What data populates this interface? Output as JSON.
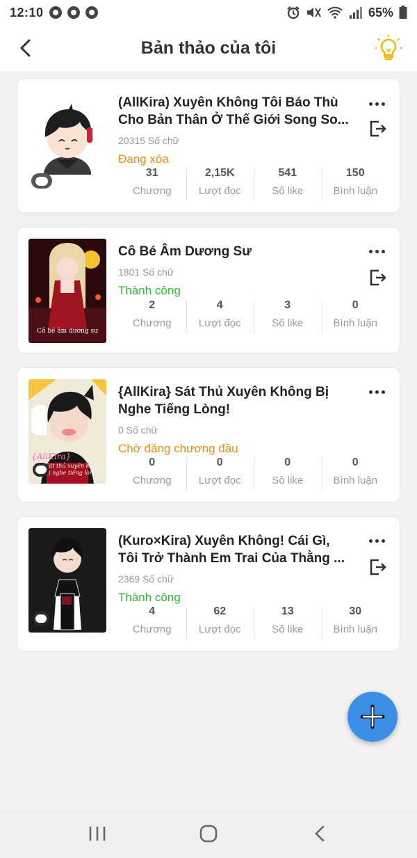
{
  "status_bar": {
    "time": "12:10",
    "battery": "65%"
  },
  "header": {
    "title": "Bản thảo của tôi",
    "back_icon": "chevron-left-icon",
    "idea_icon": "lightbulb-icon"
  },
  "stat_labels": {
    "chapters": "Chương",
    "reads": "Lượt đọc",
    "likes": "Số like",
    "comments": "Bình luận"
  },
  "drafts": [
    {
      "title_line1": "(AllKira) Xuyên Không Tôi Báo Thù",
      "title_line2": "Cho Bản Thân Ở Thế Giới Song So...",
      "word_count": "20315 Số chữ",
      "status": "Đang xóa",
      "status_color": "#f08a12",
      "chapters": "31",
      "reads": "2,15K",
      "likes": "541",
      "comments": "150"
    },
    {
      "title_line1": "Cô Bé Âm Dương Sư",
      "title_line2": "",
      "word_count": "1801 Số chữ",
      "status": "Thành công",
      "status_color": "#2fb52f",
      "cover_caption": "Cô bé âm dương sư",
      "chapters": "2",
      "reads": "4",
      "likes": "3",
      "comments": "0"
    },
    {
      "title_line1": "{AllKira} Sát Thủ Xuyên Không Bị",
      "title_line2": "Nghe Tiếng Lòng!",
      "word_count": "0 Số chữ",
      "status": "Chờ đăng chương đầu",
      "status_color": "#f08a12",
      "cover_tag": "{AllKira}",
      "cover_sub": "Sát thủ xuyên không bị nghe tiếng lòng",
      "chapters": "0",
      "reads": "0",
      "likes": "0",
      "comments": "0"
    },
    {
      "title_line1": "(Kuro×Kira) Xuyên Không! Cái Gì,",
      "title_line2": "Tôi Trở Thành Em Trai Của Thằng ...",
      "word_count": "2369 Số chữ",
      "status": "Thành công",
      "status_color": "#2fb52f",
      "chapters": "4",
      "reads": "62",
      "likes": "13",
      "comments": "30"
    }
  ],
  "fab_icon": "plus-icon",
  "nav": {
    "recents_icon": "recents-icon",
    "home_icon": "home-icon",
    "back_icon": "back-icon"
  }
}
